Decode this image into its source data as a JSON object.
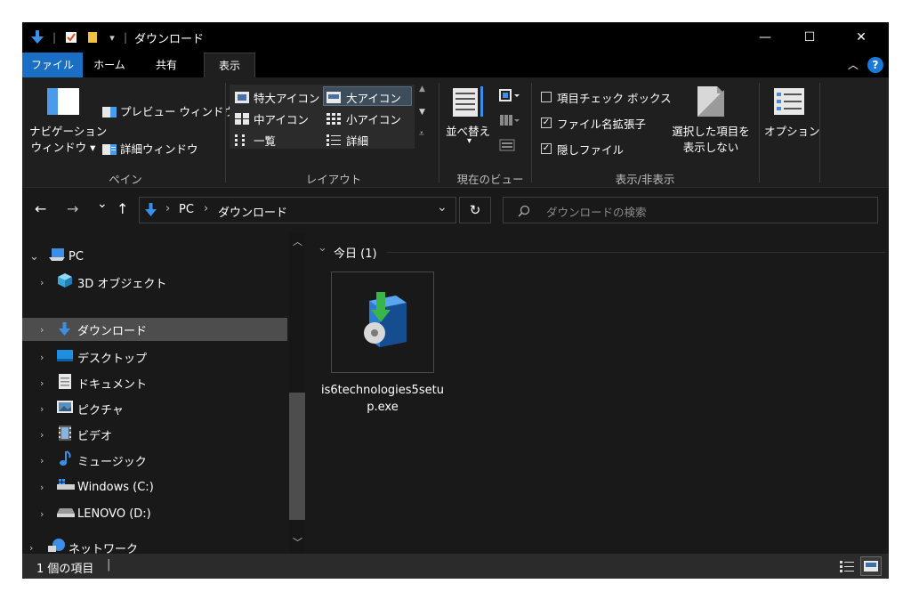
{
  "window": {
    "title": "ダウンロード",
    "title_separator": "|",
    "quick_access_dropdown": "▾",
    "minimize": "—",
    "maximize": "☐",
    "close": "✕"
  },
  "tabs": {
    "file": "ファイル",
    "home": "ホーム",
    "share": "共有",
    "view": "表示",
    "collapse_ribbon": "︿",
    "help": "?"
  },
  "ribbon": {
    "pane": {
      "nav_pane_line1": "ナビゲーション",
      "nav_pane_line2": "ウィンドウ ▾",
      "preview_window": "プレビュー ウィンドウ",
      "details_window": "詳細ウィンドウ",
      "label": "ペイン"
    },
    "layout": {
      "extra_large_icons": "特大アイコン",
      "large_icons": "大アイコン",
      "medium_icons": "中アイコン",
      "small_icons": "小アイコン",
      "list": "一覧",
      "details": "詳細",
      "label": "レイアウト"
    },
    "current_view": {
      "sort_by": "並べ替え",
      "sort_arrow": "▾",
      "label": "現在のビュー"
    },
    "show_hide": {
      "item_checkboxes": "項目チェック ボックス",
      "file_extensions": "ファイル名拡張子",
      "hidden_items": "隠しファイル",
      "check_mark": "✓",
      "hide_selected_line1": "選択した項目を",
      "hide_selected_line2": "表示しない",
      "label": "表示/非表示"
    },
    "options": {
      "label": "オプション"
    }
  },
  "address": {
    "back": "←",
    "forward": "→",
    "recent": "⌄",
    "up": "↑",
    "crumb_sep": "›",
    "crumb_pc": "PC",
    "crumb_downloads": "ダウンロード",
    "dropdown": "⌄",
    "refresh": "↻",
    "search_placeholder": "ダウンロードの検索"
  },
  "nav_pane": {
    "expanded_chevron": "⌄",
    "collapsed_chevron": "›",
    "pc": "PC",
    "items": [
      {
        "label": "3D オブジェクト"
      },
      {
        "label": "ダウンロード"
      },
      {
        "label": "デスクトップ"
      },
      {
        "label": "ドキュメント"
      },
      {
        "label": "ピクチャ"
      },
      {
        "label": "ビデオ"
      },
      {
        "label": "ミュージック"
      },
      {
        "label": "Windows (C:)"
      },
      {
        "label": "LENOVO (D:)"
      }
    ],
    "network": "ネットワーク",
    "scroll_up": "︿",
    "scroll_down": "﹀"
  },
  "content": {
    "group_chevron": "⌄",
    "group_label": "今日 (1)",
    "file_name": "is6technologies5setup.exe"
  },
  "status": {
    "item_count": "1 個の項目",
    "separator": "|"
  },
  "colors": {
    "accent": "#1a6fc4",
    "window_bg": "#191919",
    "selected_nav": "#4d4d4d"
  }
}
